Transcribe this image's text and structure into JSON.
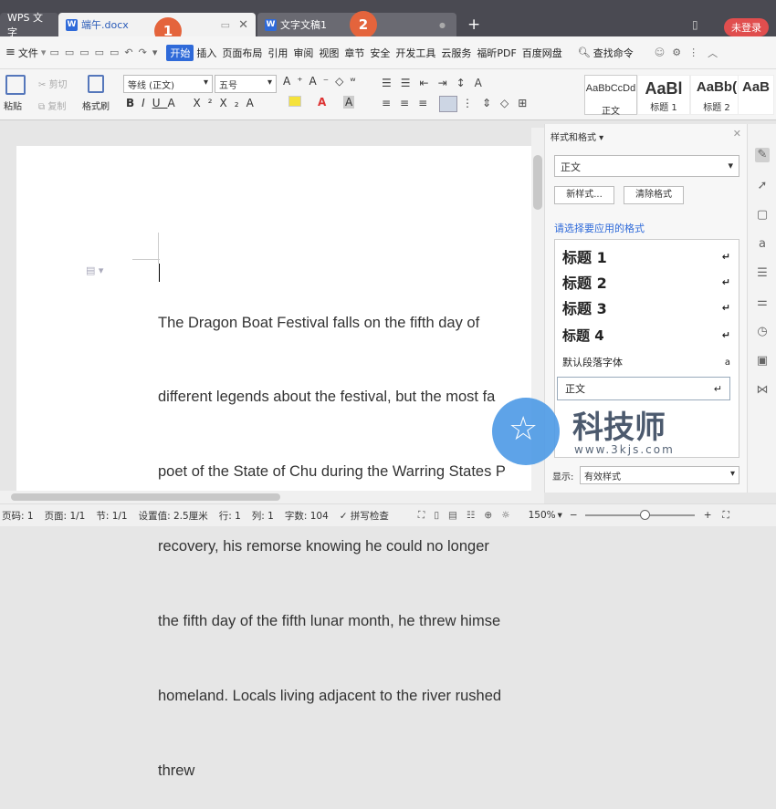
{
  "tabbar": {
    "app_tab": "WPS 文字",
    "doc_tab": "端午.docx",
    "doc_tab2": "文字文稿1",
    "login": "未登录",
    "badge1": "1",
    "badge2": "2"
  },
  "menubar": {
    "file": "文件",
    "items": [
      "开始",
      "插入",
      "页面布局",
      "引用",
      "审阅",
      "视图",
      "章节",
      "安全",
      "开发工具",
      "云服务",
      "福昕PDF",
      "百度网盘"
    ],
    "search": "查找命令"
  },
  "ribbon": {
    "paste": "粘贴",
    "cut": "剪切",
    "copy": "复制",
    "format_painter": "格式刷",
    "font": "等线 (正文)",
    "size": "五号",
    "styles": [
      {
        "preview": "AaBbCcDd",
        "label": "正文"
      },
      {
        "preview": "AaBl",
        "label": "标题 1"
      },
      {
        "preview": "AaBb(",
        "label": "标题 2"
      },
      {
        "preview": "AaB",
        "label": ""
      }
    ]
  },
  "document": {
    "lines": [
      "The Dragon Boat Festival falls on the fifth day of",
      "different legends about the festival, but the most fa",
      "poet of the State of Chu during the Warring States P",
      "recovery, his remorse knowing he could no longer",
      "the fifth day of the fifth lunar month, he threw himse",
      "homeland. Locals living adjacent to the river rushed",
      "threw"
    ]
  },
  "panel": {
    "title": "样式和格式",
    "current": "正文",
    "new_style": "新样式...",
    "clear_format": "清除格式",
    "apply_label": "请选择要应用的格式",
    "formats": [
      "标题 1",
      "标题 2",
      "标题 3",
      "标题 4",
      "默认段落字体",
      "正文"
    ],
    "show_label": "显示:",
    "show_value": "有效样式"
  },
  "watermark": {
    "brand": "科技师",
    "url": "www.3kjs.com"
  },
  "status": {
    "page_code": "页码: 1",
    "pages": "页面: 1/1",
    "section": "节: 1/1",
    "setting": "设置值: 2.5厘米",
    "row": "行: 1",
    "col": "列: 1",
    "words": "字数: 104",
    "spell": "拼写检查",
    "zoom": "150%"
  }
}
